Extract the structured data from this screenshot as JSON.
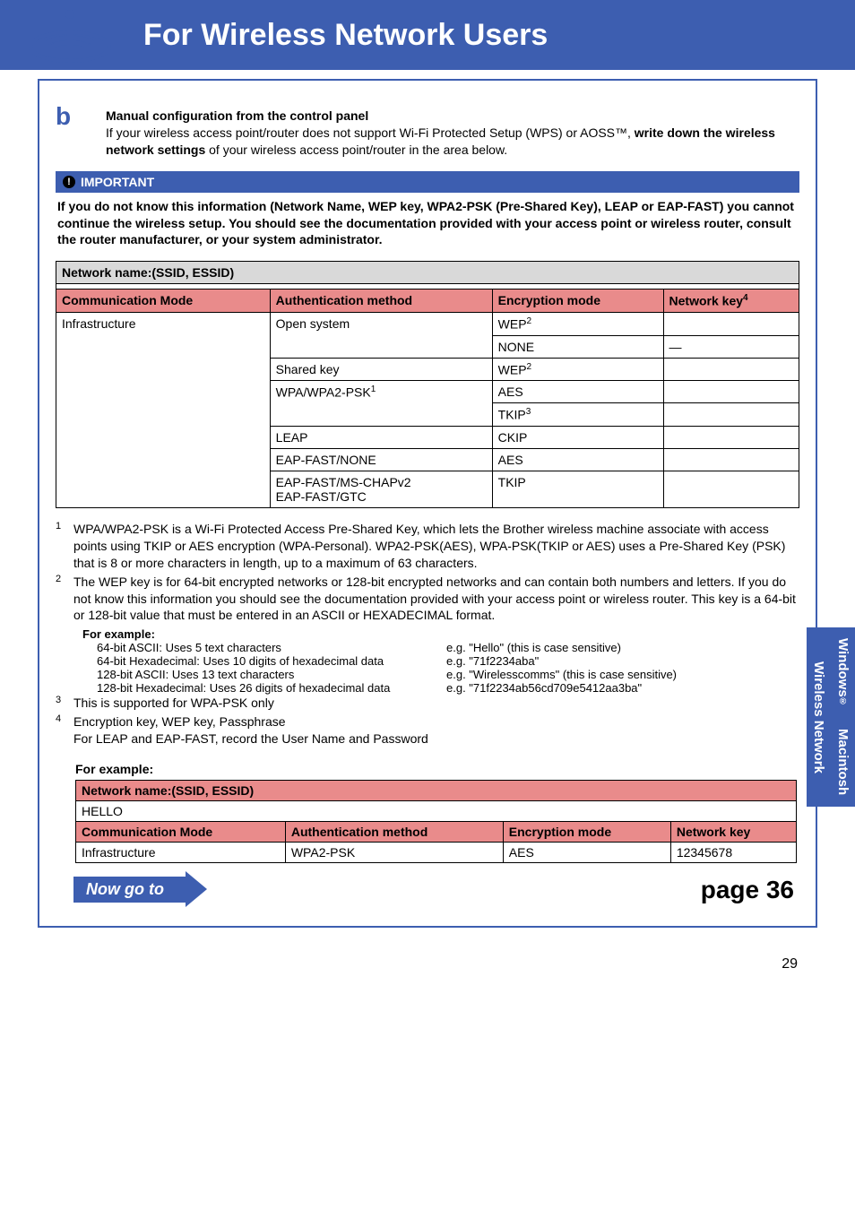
{
  "header": {
    "title": "For Wireless Network Users"
  },
  "step": {
    "letter": "b",
    "title": "Manual configuration from the control panel",
    "body_pre": "If your wireless access point/router does not support Wi-Fi Protected Setup (WPS) or AOSS™, ",
    "body_bold": "write down the wireless network settings",
    "body_post": " of your wireless access point/router in the area below."
  },
  "important": {
    "label": "IMPORTANT",
    "text": "If you do not know this information (Network Name, WEP key, WPA2-PSK (Pre-Shared Key), LEAP or EAP-FAST) you cannot continue the wireless setup. You should see the documentation provided with your access point or wireless router, consult the router manufacturer, or your system administrator."
  },
  "net": {
    "ssid_label": "Network name:(SSID, ESSID)",
    "cols": {
      "comm": "Communication Mode",
      "auth": "Authentication method",
      "enc": "Encryption mode",
      "key": "Network key",
      "key_sup": "4"
    },
    "rows": [
      {
        "comm": "Infrastructure",
        "auth": "Open system",
        "enc": "WEP",
        "enc_sup": "2",
        "key": ""
      },
      {
        "comm": "",
        "auth": "",
        "enc": "NONE",
        "enc_sup": "",
        "key": "—"
      },
      {
        "comm": "",
        "auth": "Shared key",
        "enc": "WEP",
        "enc_sup": "2",
        "key": ""
      },
      {
        "comm": "",
        "auth": "WPA/WPA2-PSK",
        "auth_sup": "1",
        "enc": "AES",
        "enc_sup": "",
        "key": ""
      },
      {
        "comm": "",
        "auth": "",
        "enc": "TKIP",
        "enc_sup": "3",
        "key": ""
      },
      {
        "comm": "",
        "auth": "LEAP",
        "enc": "CKIP",
        "enc_sup": "",
        "key": ""
      },
      {
        "comm": "",
        "auth": "EAP-FAST/NONE",
        "enc": "AES",
        "enc_sup": "",
        "key": ""
      },
      {
        "comm": "",
        "auth": "EAP-FAST/MS-CHAPv2\nEAP-FAST/GTC",
        "enc": "TKIP",
        "enc_sup": "",
        "key": ""
      }
    ]
  },
  "footnotes": {
    "1": "WPA/WPA2-PSK is a Wi-Fi Protected Access Pre-Shared Key, which lets the Brother wireless machine associate with access points using TKIP or AES encryption (WPA-Personal). WPA2-PSK(AES), WPA-PSK(TKIP or AES) uses a Pre-Shared Key (PSK) that is 8 or more characters in length, up to a maximum of 63 characters.",
    "2": "The WEP key is for 64-bit encrypted networks or 128-bit encrypted networks and can contain both numbers and letters. If you do not know this information you should see the documentation provided with your access point or wireless router. This key is a 64-bit or 128-bit value that must be entered in an ASCII or HEXADECIMAL format.",
    "3": "This is supported for WPA-PSK only",
    "4a": "Encryption key, WEP key, Passphrase",
    "4b": "For LEAP and EAP-FAST, record the User Name and Password"
  },
  "examples": {
    "heading": "For example:",
    "rows": [
      {
        "l": "64-bit ASCII: Uses 5 text characters",
        "r": "e.g. \"Hello\" (this is case sensitive)"
      },
      {
        "l": "64-bit Hexadecimal: Uses 10 digits of hexadecimal data",
        "r": "e.g. \"71f2234aba\""
      },
      {
        "l": "128-bit ASCII: Uses 13 text characters",
        "r": "e.g. \"Wirelesscomms\" (this is case sensitive)"
      },
      {
        "l": "128-bit Hexadecimal: Uses 26 digits of hexadecimal data",
        "r": "e.g. \"71f2234ab56cd709e5412aa3ba\""
      }
    ]
  },
  "example2": {
    "heading": "For example:",
    "ssid_label": "Network name:(SSID, ESSID)",
    "ssid_value": "HELLO",
    "cols": {
      "comm": "Communication Mode",
      "auth": "Authentication method",
      "enc": "Encryption mode",
      "key": "Network key"
    },
    "row": {
      "comm": "Infrastructure",
      "auth": "WPA2-PSK",
      "enc": "AES",
      "key": "12345678"
    }
  },
  "nowgo": {
    "label": "Now go to",
    "page": "page 36"
  },
  "tabs": {
    "win": "Windows",
    "mac": "Macintosh",
    "wn": "Wireless Network"
  },
  "page_number": "29"
}
